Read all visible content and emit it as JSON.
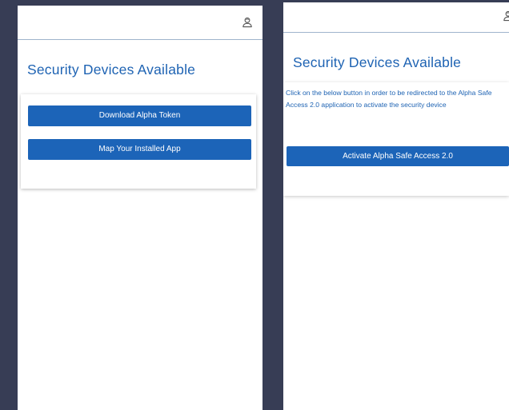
{
  "left_screen": {
    "title": "Security Devices Available",
    "download_button": "Download Alpha Token",
    "map_button": "Map Your Installed App",
    "user_icon": "user-icon"
  },
  "right_screen": {
    "title": "Security Devices Available",
    "description": "Click on the below button in order to be redirected to the Alpha Safe Access 2.0 application to activate the security device",
    "activate_button": "Activate Alpha Safe Access 2.0",
    "user_icon": "user-icon"
  },
  "colors": {
    "background": "#373d55",
    "accent": "#1e63b3",
    "button": "#1c64b8"
  }
}
